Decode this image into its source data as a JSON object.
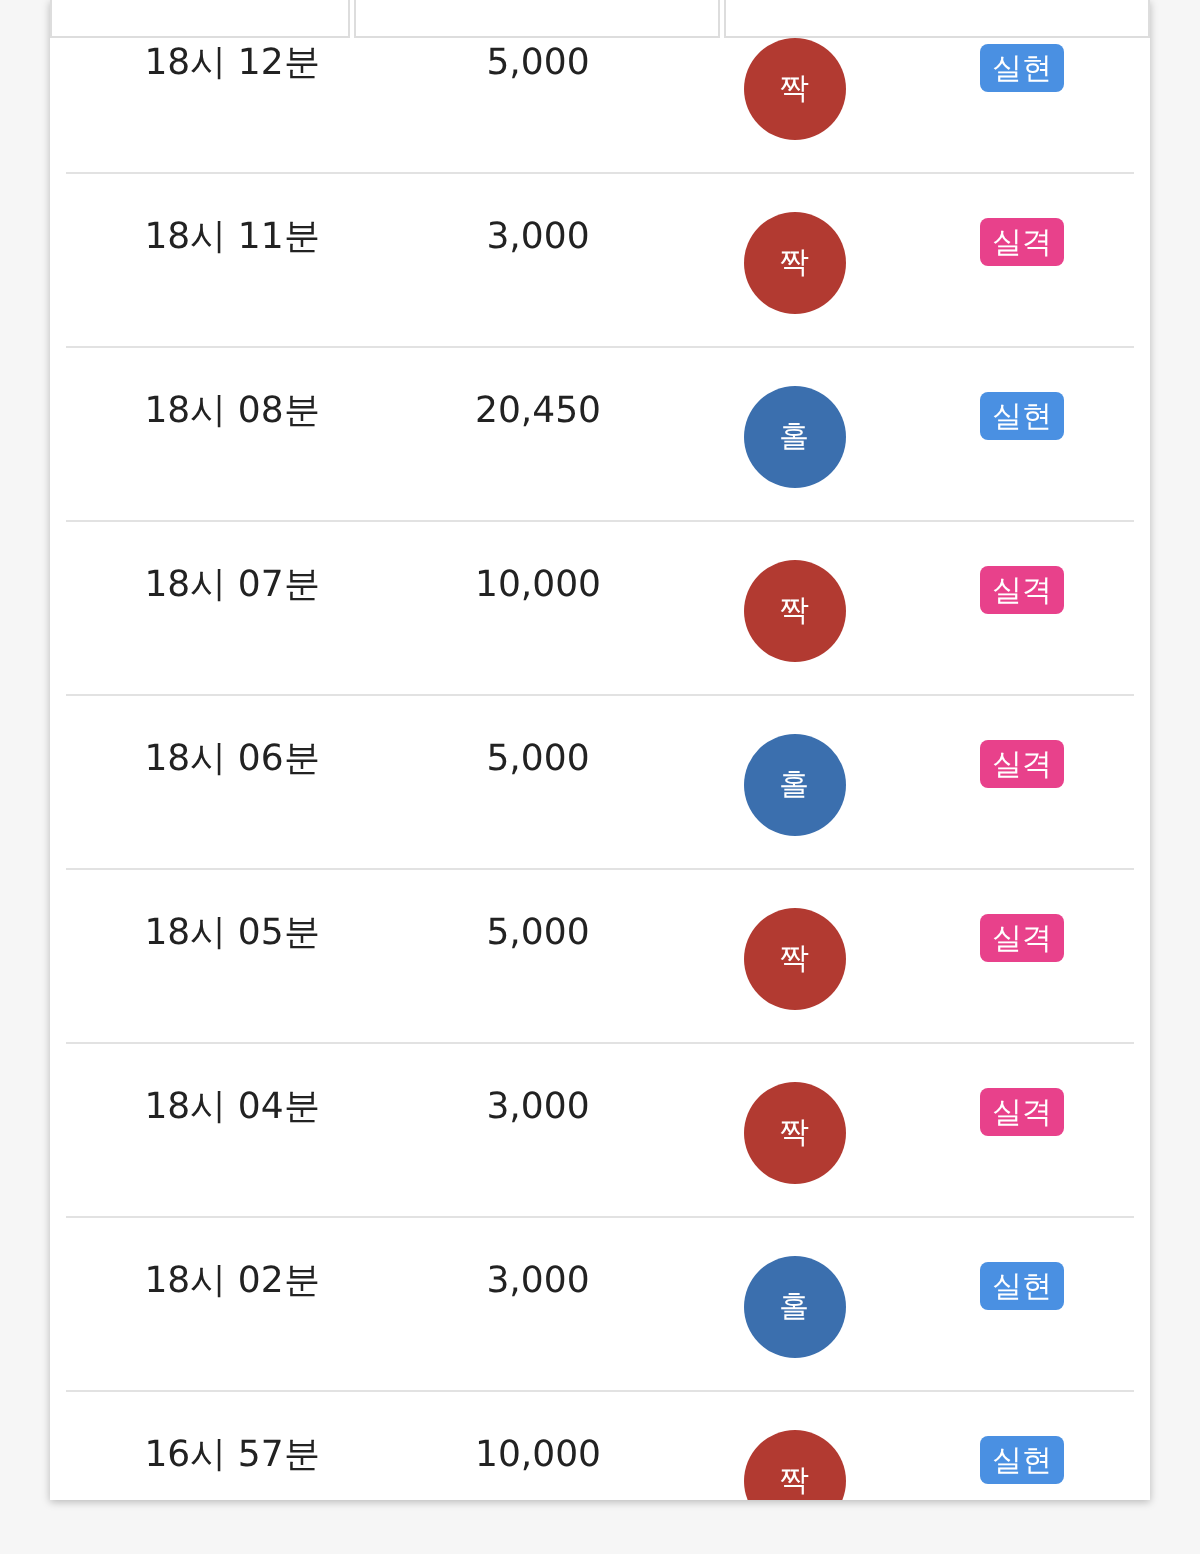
{
  "tabs": [
    {
      "kind": "tab"
    },
    {
      "kind": "tab"
    },
    {
      "kind": "tab"
    }
  ],
  "rows": [
    {
      "time": "18시 12분",
      "amount": "5,000",
      "ball": {
        "label": "짝",
        "color": "#b23a31"
      },
      "badge": {
        "label": "실현",
        "color": "#4a90e2"
      }
    },
    {
      "time": "18시 11분",
      "amount": "3,000",
      "ball": {
        "label": "짝",
        "color": "#b23a31"
      },
      "badge": {
        "label": "실격",
        "color": "#e8418b"
      }
    },
    {
      "time": "18시 08분",
      "amount": "20,450",
      "ball": {
        "label": "홀",
        "color": "#3b6fae"
      },
      "badge": {
        "label": "실현",
        "color": "#4a90e2"
      }
    },
    {
      "time": "18시 07분",
      "amount": "10,000",
      "ball": {
        "label": "짝",
        "color": "#b23a31"
      },
      "badge": {
        "label": "실격",
        "color": "#e8418b"
      }
    },
    {
      "time": "18시 06분",
      "amount": "5,000",
      "ball": {
        "label": "홀",
        "color": "#3b6fae"
      },
      "badge": {
        "label": "실격",
        "color": "#e8418b"
      }
    },
    {
      "time": "18시 05분",
      "amount": "5,000",
      "ball": {
        "label": "짝",
        "color": "#b23a31"
      },
      "badge": {
        "label": "실격",
        "color": "#e8418b"
      }
    },
    {
      "time": "18시 04분",
      "amount": "3,000",
      "ball": {
        "label": "짝",
        "color": "#b23a31"
      },
      "badge": {
        "label": "실격",
        "color": "#e8418b"
      }
    },
    {
      "time": "18시 02분",
      "amount": "3,000",
      "ball": {
        "label": "홀",
        "color": "#3b6fae"
      },
      "badge": {
        "label": "실현",
        "color": "#4a90e2"
      }
    },
    {
      "time": "16시 57분",
      "amount": "10,000",
      "ball": {
        "label": "짝",
        "color": "#b23a31"
      },
      "badge": {
        "label": "실현",
        "color": "#4a90e2"
      }
    }
  ]
}
